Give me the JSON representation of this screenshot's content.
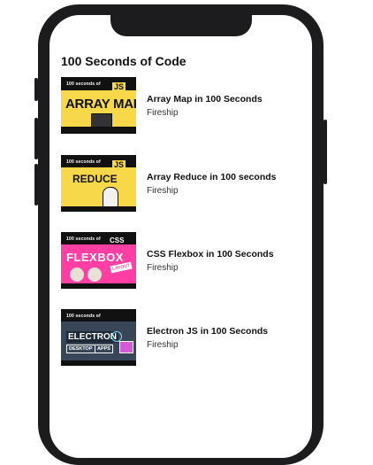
{
  "list": {
    "title": "100 Seconds of Code"
  },
  "items": [
    {
      "title": "Array Map in 100 Seconds",
      "channel": "Fireship",
      "thumb": {
        "tag": "100 seconds of",
        "lang": "JS",
        "big": "ARRAY MAP"
      }
    },
    {
      "title": "Array Reduce in 100 seconds",
      "channel": "Fireship",
      "thumb": {
        "tag": "100 seconds of",
        "lang": "JS",
        "big": "REDUCE"
      }
    },
    {
      "title": "CSS Flexbox in 100 Seconds",
      "channel": "Fireship",
      "thumb": {
        "tag": "100 seconds of",
        "lang": "CSS",
        "big": "FLEXBOX",
        "badge": "LAYOUT"
      }
    },
    {
      "title": "Electron JS in 100 Seconds",
      "channel": "Fireship",
      "thumb": {
        "tag": "100 seconds of",
        "lang": "",
        "big": "ELECTRON",
        "line2a": "DESKTOP",
        "line2b": "APPS"
      }
    }
  ],
  "colors": {
    "yellow": "#f7d84a",
    "magenta": "#ff3fa4",
    "slate": "#39465a",
    "frame": "#1c1c1e"
  }
}
